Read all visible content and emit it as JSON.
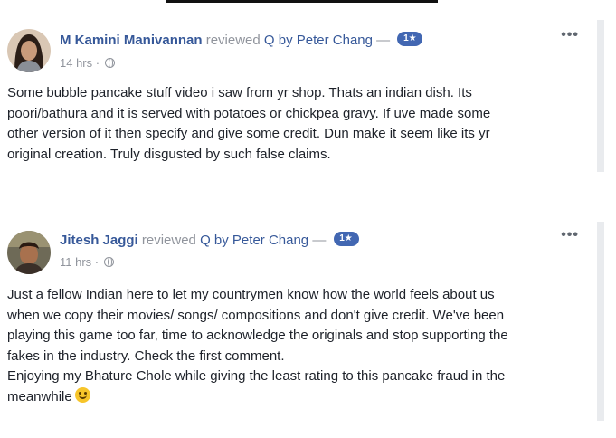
{
  "reviews": [
    {
      "author": "M Kamini Manivannan",
      "verb": "reviewed",
      "page": "Q by Peter Chang",
      "dash": "—",
      "rating_badge": "1★",
      "time": "14 hrs",
      "separator": "·",
      "privacy_icon": "globe-icon",
      "more_label": "•••",
      "lines": [
        "Some bubble pancake stuff video i saw from yr shop. Thats an indian dish. Its",
        "poori/bathura and it is served with potatoes or chickpea gravy. If uve made some",
        "other version of it then specify and give some credit. Dun make it seem like its yr",
        "original creation. Truly disgusted by such false claims."
      ]
    },
    {
      "author": "Jitesh Jaggi",
      "verb": "reviewed",
      "page": "Q by Peter Chang",
      "dash": "—",
      "rating_badge": "1★",
      "time": "11 hrs",
      "separator": "·",
      "privacy_icon": "globe-icon",
      "more_label": "•••",
      "lines": [
        "Just a fellow Indian here to let my countrymen know how the world feels about us",
        "when we copy their movies/ songs/ compositions and don't give credit. We've been",
        "playing this game too far, time to acknowledge the originals and stop supporting the",
        "fakes in the industry. Check the first comment.",
        "Enjoying my Bhature Chole while giving the least rating to this pancake fraud in the",
        "meanwhile"
      ],
      "trailing_emoji": "smiley-emoji-icon"
    }
  ],
  "colors": {
    "link": "#365899",
    "muted": "#90949c",
    "badge": "#4267b2",
    "text": "#1d2129"
  }
}
